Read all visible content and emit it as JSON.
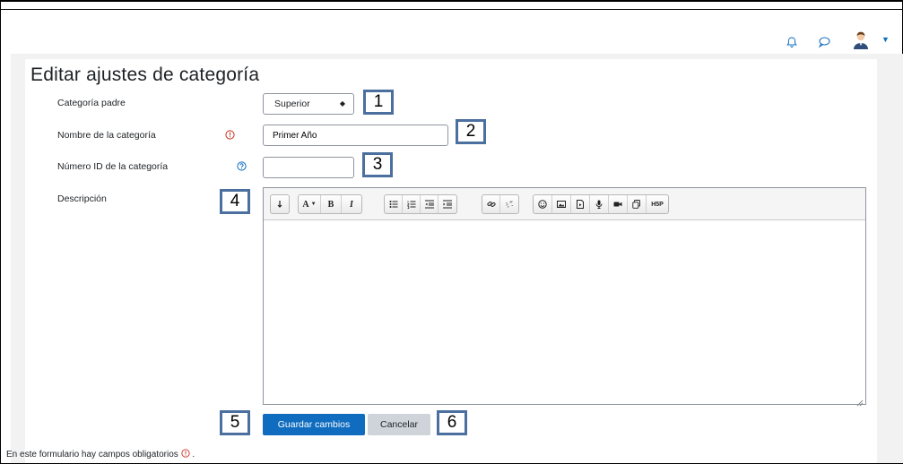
{
  "header": {
    "notification_icon": "bell-icon",
    "messages_icon": "chat-bubble-icon",
    "user_menu_icon": "avatar",
    "accent_color": "#0f6cbf"
  },
  "page": {
    "title": "Editar ajustes de categoría"
  },
  "form": {
    "parent": {
      "label": "Categoría padre",
      "selected": "Superior"
    },
    "name": {
      "label": "Nombre de la categoría",
      "value": "Primer Año",
      "required": true
    },
    "idnumber": {
      "label": "Número ID de la categoría",
      "value": "",
      "help": true
    },
    "description": {
      "label": "Descripción",
      "value": ""
    },
    "save_label": "Guardar cambios",
    "cancel_label": "Cancelar",
    "required_note": "En este formulario hay campos obligatorios",
    "required_note_suffix": " ."
  },
  "toolbar": {
    "items": [
      "collapse",
      "font-color",
      "bold",
      "italic",
      "unordered-list",
      "ordered-list",
      "indent",
      "outdent",
      "link",
      "unlink",
      "emoji",
      "image",
      "media",
      "record-audio",
      "record-video",
      "manage-files",
      "h5p"
    ],
    "labels": {
      "font": "A",
      "bold": "B",
      "italic": "I",
      "h5p": "H5P"
    }
  },
  "callouts": [
    "1",
    "2",
    "3",
    "4",
    "5",
    "6"
  ],
  "colors": {
    "primary": "#0f6cbf",
    "required": "#ca3120",
    "callout_border": "#4b6f9e",
    "secondary_button": "#ced4da"
  }
}
